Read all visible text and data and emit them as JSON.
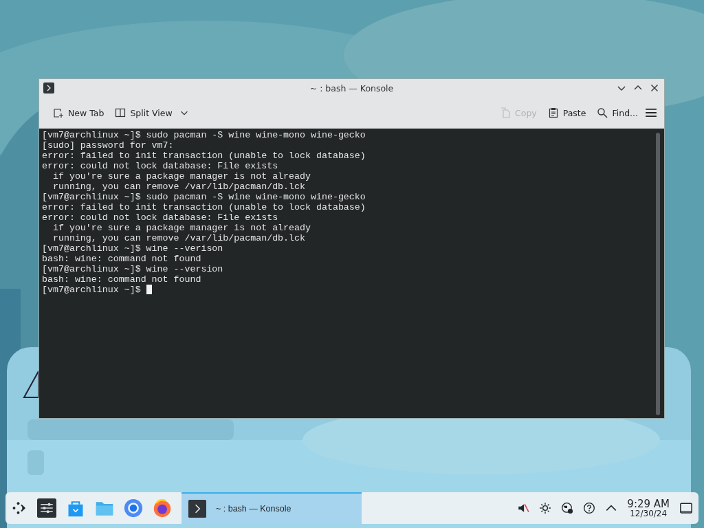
{
  "window": {
    "title": "~ : bash — Konsole",
    "toolbar": [
      {
        "kind": "new-tab",
        "label": "New Tab",
        "disabled": false
      },
      {
        "kind": "split-view",
        "label": "Split View",
        "disabled": false
      },
      {
        "kind": "copy",
        "label": "Copy",
        "disabled": true
      },
      {
        "kind": "paste",
        "label": "Paste",
        "disabled": false
      },
      {
        "kind": "find",
        "label": "Find...",
        "disabled": false
      }
    ],
    "terminal": {
      "lines": [
        "[vm7@archlinux ~]$ sudo pacman -S wine wine-mono wine-gecko",
        "[sudo] password for vm7:",
        "error: failed to init transaction (unable to lock database)",
        "error: could not lock database: File exists",
        "  if you're sure a package manager is not already",
        "  running, you can remove /var/lib/pacman/db.lck",
        "[vm7@archlinux ~]$ sudo pacman -S wine wine-mono wine-gecko",
        "error: failed to init transaction (unable to lock database)",
        "error: could not lock database: File exists",
        "  if you're sure a package manager is not already",
        "  running, you can remove /var/lib/pacman/db.lck",
        "[vm7@archlinux ~]$ wine --verison",
        "bash: wine: command not found",
        "[vm7@archlinux ~]$ wine --version",
        "bash: wine: command not found",
        "[vm7@archlinux ~]$"
      ],
      "cursor": true
    }
  },
  "taskbar": {
    "tasks": [
      {
        "title": "~ : bash — Konsole",
        "selected": true
      }
    ],
    "clock": {
      "time": "9:29 AM",
      "date": "12/30/24"
    }
  }
}
